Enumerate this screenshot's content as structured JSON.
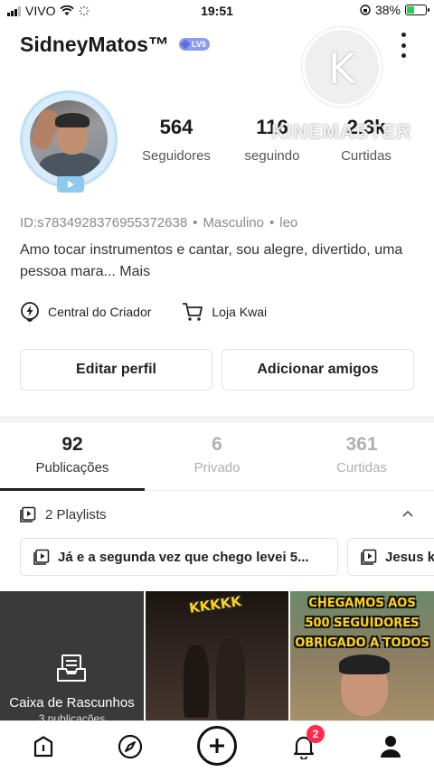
{
  "status_bar": {
    "carrier": "VIVO",
    "time": "19:51",
    "battery": "38%",
    "battery_fraction": 0.38
  },
  "profile": {
    "username": "SidneyMatos™",
    "level": "LV5",
    "stats": [
      {
        "value": "564",
        "label": "Seguidores"
      },
      {
        "value": "116",
        "label": "seguindo"
      },
      {
        "value": "2.3k",
        "label": "Curtidas"
      }
    ],
    "id": "ID:s7834928376955372638",
    "gender": "Masculino",
    "sign": "leo",
    "bio": "Amo tocar instrumentos e cantar, sou alegre, divertido, uma pessoa mara...",
    "bio_more": "Mais"
  },
  "watermark": {
    "logo_letter": "K",
    "text": "KINEMASTER"
  },
  "links": {
    "creator_center": "Central do Criador",
    "shop": "Loja Kwai"
  },
  "actions": {
    "edit_profile": "Editar perfil",
    "add_friends": "Adicionar amigos"
  },
  "tabs": [
    {
      "count": "92",
      "label": "Publicações",
      "active": true
    },
    {
      "count": "6",
      "label": "Privado",
      "active": false
    },
    {
      "count": "361",
      "label": "Curtidas",
      "active": false
    }
  ],
  "playlists": {
    "header": "2 Playlists",
    "items": [
      "Já e a segunda vez que chego levei 5...",
      "Jesus k"
    ]
  },
  "grid": {
    "drafts_label": "Caixa de Rascunhos",
    "drafts_count": "3 publicações",
    "video2_sticker": "KKKKK",
    "video3_caption": [
      "CHEGAMOS AOS",
      "500 SEGUIDORES",
      "OBRIGADO A TODOS"
    ]
  },
  "bottom_nav": {
    "notification_count": "2"
  }
}
